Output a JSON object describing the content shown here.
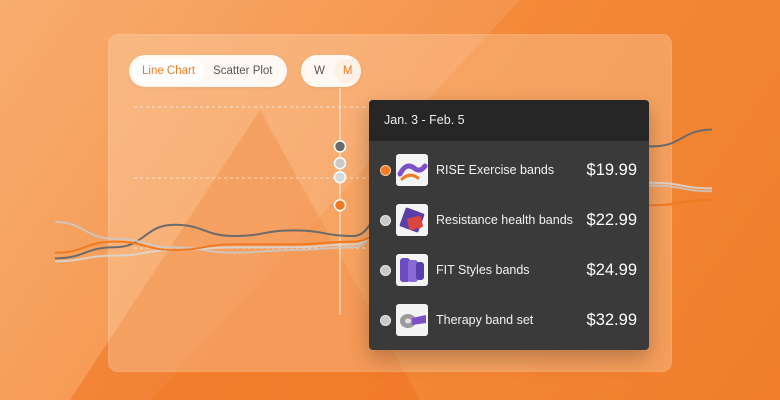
{
  "toggles": {
    "chart_type": {
      "options": [
        "Line Chart",
        "Scatter Plot"
      ],
      "selected": "Line Chart"
    },
    "period": {
      "options": [
        "W",
        "M"
      ],
      "selected": "M"
    }
  },
  "tooltip": {
    "date_range": "Jan. 3 - Feb. 5",
    "items": [
      {
        "name": "RISE Exercise bands",
        "price": "$19.99",
        "dot_color": "#f07a22",
        "icon": "purple-bands-icon"
      },
      {
        "name": "Resistance health bands",
        "price": "$22.99",
        "dot_color": "#c8c8c8",
        "icon": "purple-red-bands-icon"
      },
      {
        "name": "FIT Styles bands",
        "price": "$24.99",
        "dot_color": "#c8c8c8",
        "icon": "purple-loop-bands-icon"
      },
      {
        "name": "Therapy band set",
        "price": "$32.99",
        "dot_color": "#c8c8c8",
        "icon": "gray-purple-band-roll-icon"
      }
    ]
  },
  "chart_data": {
    "type": "line",
    "series": [
      {
        "color": "#6b6b6b",
        "values": [
          2.2,
          2.6,
          3.4,
          3.0,
          3.2,
          3.0,
          6.2,
          6.2,
          6.2,
          6.2,
          6.2,
          6.8
        ]
      },
      {
        "color": "#c9c9c9",
        "values": [
          3.5,
          2.9,
          2.6,
          2.4,
          2.5,
          2.6,
          5.6,
          5.5,
          5.2,
          5.0,
          4.8,
          4.6
        ]
      },
      {
        "color": "#d8d8d8",
        "values": [
          2.1,
          2.3,
          2.5,
          2.6,
          2.6,
          2.7,
          5.1,
          5.0,
          5.1,
          5.0,
          4.9,
          4.7
        ]
      },
      {
        "color": "#f07a22",
        "values": [
          2.4,
          2.8,
          2.5,
          2.7,
          2.7,
          2.8,
          4.1,
          4.1,
          4.1,
          4.1,
          4.1,
          4.3
        ]
      }
    ],
    "highlight_index": 6
  }
}
